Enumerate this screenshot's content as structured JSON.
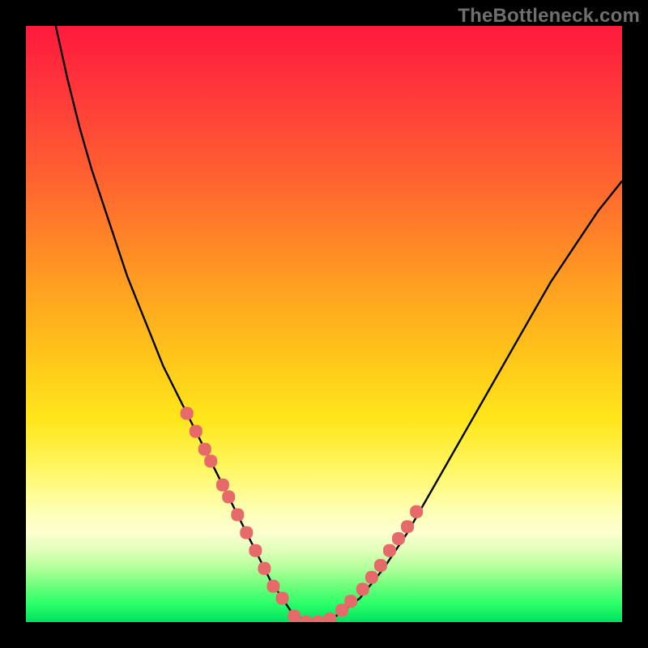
{
  "watermark": "TheBottleneck.com",
  "colors": {
    "background": "#000000",
    "curve_stroke": "#000000",
    "marker_fill": "#e76a6a",
    "marker_stroke": "#d85a5a"
  },
  "chart_data": {
    "type": "line",
    "title": "",
    "xlabel": "",
    "ylabel": "",
    "xlim": [
      0,
      100
    ],
    "ylim": [
      0,
      100
    ],
    "grid": false,
    "series": [
      {
        "name": "bottleneck-curve",
        "x": [
          5,
          7,
          9,
          11,
          13,
          15,
          17,
          19,
          21,
          23,
          25,
          27,
          29,
          31,
          33,
          35,
          37,
          39,
          41,
          43,
          45,
          48,
          52,
          56,
          60,
          64,
          68,
          72,
          76,
          80,
          84,
          88,
          92,
          96,
          100
        ],
        "y": [
          100,
          91,
          83,
          76,
          70,
          64,
          58,
          53,
          48,
          43,
          39,
          35,
          31,
          27,
          23,
          19,
          15,
          11,
          7,
          4,
          1,
          0,
          1,
          4,
          9,
          15,
          22,
          29,
          36,
          43,
          50,
          57,
          63,
          69,
          74
        ]
      }
    ],
    "markers": {
      "name": "highlighted-points",
      "x": [
        27,
        28.5,
        30,
        31,
        33,
        34,
        35.5,
        37,
        38.5,
        40,
        41.5,
        43,
        45,
        47,
        49,
        51,
        53,
        54.5,
        56.5,
        58,
        59.5,
        61,
        62.5,
        64,
        65.5
      ],
      "y": [
        35,
        32,
        29,
        27,
        23,
        21,
        18,
        15,
        12,
        9,
        6,
        4,
        1,
        0,
        0,
        0.5,
        2,
        3.5,
        5.5,
        7.5,
        9.5,
        12,
        14,
        16,
        18.5
      ]
    }
  }
}
